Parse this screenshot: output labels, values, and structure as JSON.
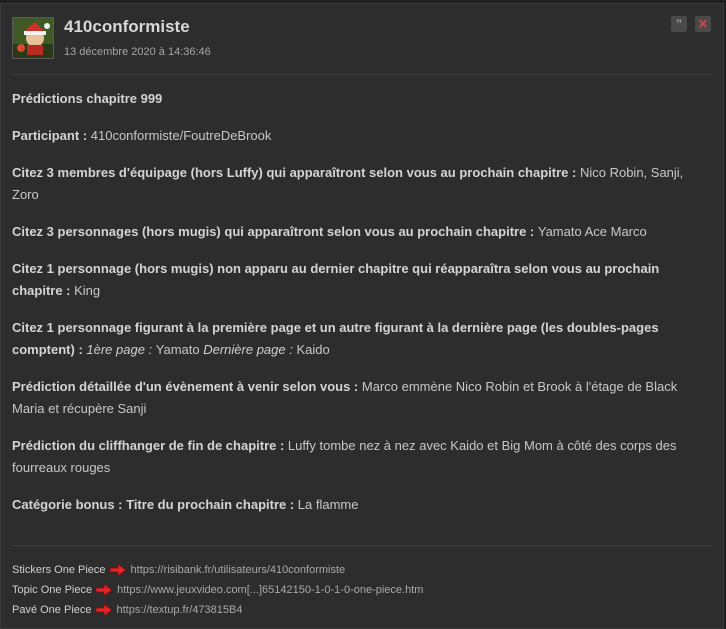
{
  "post": {
    "author": "410conformiste",
    "date": "13 décembre 2020 à 14:36:46",
    "quote_icon": "quote-icon",
    "delete_icon": "close-icon",
    "quote_glyph": "”",
    "delete_glyph": "✕"
  },
  "content": {
    "title": "Prédictions chapitre 999",
    "participant_label": "Participant : ",
    "participant_value": "410conformiste/FoutreDeBrook",
    "q1_label": "Citez 3 membres d'équipage (hors Luffy) qui apparaîtront selon vous au prochain chapitre : ",
    "q1_value": "Nico Robin, Sanji, Zoro",
    "q2_label": "Citez 3 personnages (hors mugis) qui apparaîtront selon vous au prochain chapitre : ",
    "q2_value": "Yamato Ace Marco",
    "q3_label": "Citez 1 personnage (hors mugis) non apparu au dernier chapitre qui réapparaîtra selon vous au prochain chapitre : ",
    "q3_value": "King",
    "q4_label": "Citez 1 personnage figurant à la première page et un autre figurant à la dernière page (les doubles-pages comptent) : ",
    "q4_first_label": "1ère page : ",
    "q4_first_value": "Yamato ",
    "q4_last_label": "Dernière page : ",
    "q4_last_value": "Kaido",
    "q5_label": "Prédiction détaillée d'un évènement à venir selon vous : ",
    "q5_value": "Marco emmène Nico Robin et Brook à l'étage de Black Maria et récupère Sanji",
    "q6_label": "Prédiction du cliffhanger de fin de chapitre : ",
    "q6_value": "Luffy tombe nez à nez avec Kaido et Big Mom à côté des corps des fourreaux rouges",
    "q7_label": "Catégorie bonus : Titre du prochain chapitre : ",
    "q7_value": "La flamme"
  },
  "signature": {
    "rows": [
      {
        "label": "Stickers One Piece",
        "url": "https://risibank.fr/utilisateurs/410conformiste"
      },
      {
        "label": "Topic One Piece",
        "url": "https://www.jeuxvideo.com[...]65142150-1-0-1-0-one-piece.htm"
      },
      {
        "label": "Pavé One Piece",
        "url": "https://textup.fr/473815B4"
      }
    ]
  },
  "colors": {
    "background": "#2d2d2d",
    "text": "#cfcfcf",
    "arrow": "#e0262a",
    "close": "#d64a4a"
  }
}
